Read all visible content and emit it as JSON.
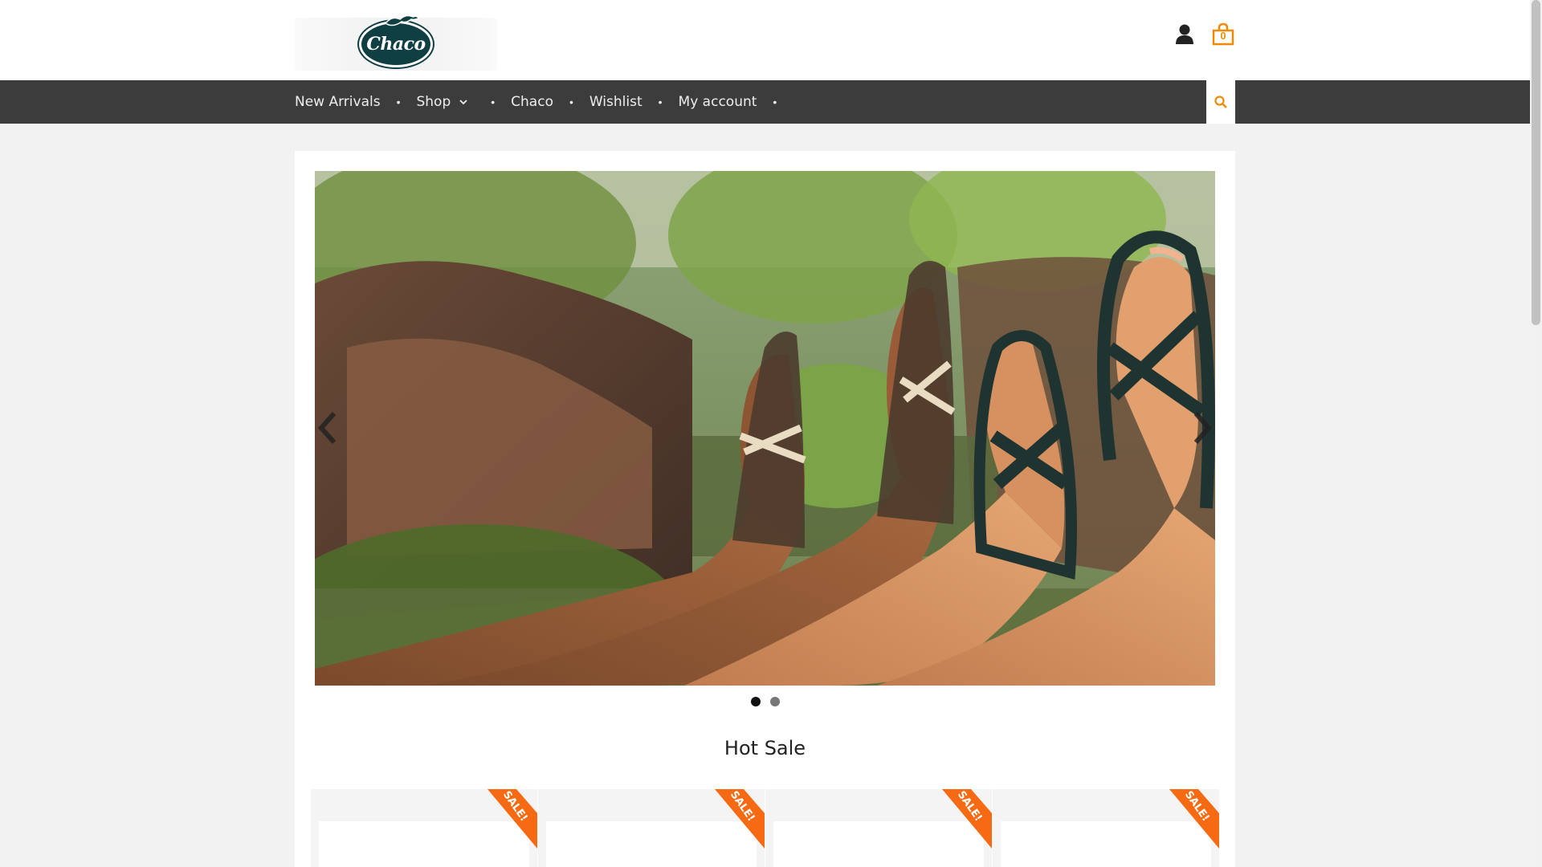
{
  "brand": {
    "logo_text": "Chaco"
  },
  "header": {
    "cart_count": "0"
  },
  "nav": {
    "items": [
      "New Arrivals",
      "Shop",
      "Chaco",
      "Wishlist",
      "My account"
    ]
  },
  "slider": {
    "slide_count": 2,
    "active_slide": 1
  },
  "section": {
    "title": "Hot Sale"
  },
  "products": [
    {
      "badge": "SALE!"
    },
    {
      "badge": "SALE!"
    },
    {
      "badge": "SALE!"
    },
    {
      "badge": "SALE!"
    }
  ],
  "colors": {
    "accent": "#f08a00",
    "nav_bg": "#3c3c3c",
    "sale_ribbon": "#f56a12",
    "brand": "#0f3f43"
  }
}
